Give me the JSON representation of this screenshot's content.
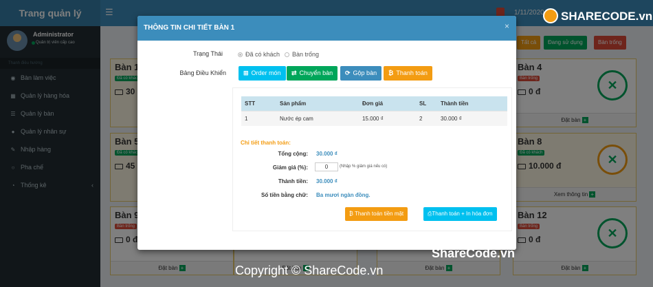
{
  "app": {
    "brand": "Trang quản lý",
    "date": "1/11/2020"
  },
  "user": {
    "name": "Administrator",
    "role": "Quản trị viên cấp cao"
  },
  "nav": {
    "header": "Thanh điều hướng",
    "items": [
      {
        "label": "Bàn làm việc",
        "icon": "dashboard-icon"
      },
      {
        "label": "Quản lý hàng hóa",
        "icon": "grid-icon"
      },
      {
        "label": "Quản lý bàn",
        "icon": "list-icon"
      },
      {
        "label": "Quản lý nhân sự",
        "icon": "user-icon"
      },
      {
        "label": "Nhập hàng",
        "icon": "edit-icon"
      },
      {
        "label": "Pha chế",
        "icon": "circle-icon"
      },
      {
        "label": "Thống kê",
        "icon": "pie-chart-icon"
      }
    ]
  },
  "filters": {
    "all": "Tất cả",
    "in_use": "Đang sử dụng",
    "empty": "Bàn trống"
  },
  "tables": [
    {
      "name": "Bàn 1",
      "badge": "Đã có khách",
      "money": "30",
      "footer": ""
    },
    {
      "name": "Bàn 4",
      "badge": "Bàn trống",
      "money": "0 đ",
      "footer": "Đặt bàn"
    },
    {
      "name": "Bàn 5",
      "badge": "Đã có khách",
      "money": "45",
      "footer": ""
    },
    {
      "name": "Bàn 8",
      "badge": "Đã có khách",
      "money": "10.000 đ",
      "footer": "Xem thông tin"
    },
    {
      "name": "Bàn 9",
      "badge": "Bàn trống",
      "money": "0 đ",
      "footer": "Đặt bàn"
    },
    {
      "name": "Bàn 12",
      "badge": "Bàn trống",
      "money": "0 đ",
      "footer": "Đặt bàn"
    },
    {
      "footer": "Đặt bàn"
    },
    {
      "footer": "Đặt bàn"
    }
  ],
  "modal": {
    "title": "THÔNG TIN CHI TIẾT BÀN 1",
    "close": "×",
    "status_label": "Trạng Thái",
    "status_options": [
      "Đã có khách",
      "Bàn trống"
    ],
    "control_label": "Bảng Điều Khiển",
    "actions": {
      "order": "Order món",
      "transfer": "Chuyển bàn",
      "merge": "Gộp bàn",
      "pay": "Thanh toán"
    },
    "columns": [
      "STT",
      "Sản phẩm",
      "Đơn giá",
      "SL",
      "Thành tiền"
    ],
    "rows": [
      [
        "1",
        "Nước ép cam",
        "15.000 ₫",
        "2",
        "30.000 ₫"
      ]
    ],
    "pay_heading": "Chi tiết thanh toán:",
    "total_label": "Tổng cộng:",
    "total_value": "30.000 ₫",
    "discount_label": "Giảm giá (%):",
    "discount_value": "0",
    "discount_hint": "(Nhập % giảm giá nếu có)",
    "final_label": "Thành tiền:",
    "final_value": "30.000 ₫",
    "words_label": "Số tiền bằng chữ:",
    "words_value": "Ba mươi ngàn đồng.",
    "cash_button": "Thanh toán tiền mặt",
    "print_button": "Thanh toán + In hóa đơn"
  },
  "watermark": {
    "logo": "SHARECODE.vn",
    "side": "ShareCode.vn",
    "copyright": "Copyright © ShareCode.vn"
  },
  "colors": {
    "primary": "#3c8dbc",
    "success": "#00a65a",
    "info": "#00c0ef",
    "warning": "#f39c12",
    "danger": "#dd4b39"
  }
}
